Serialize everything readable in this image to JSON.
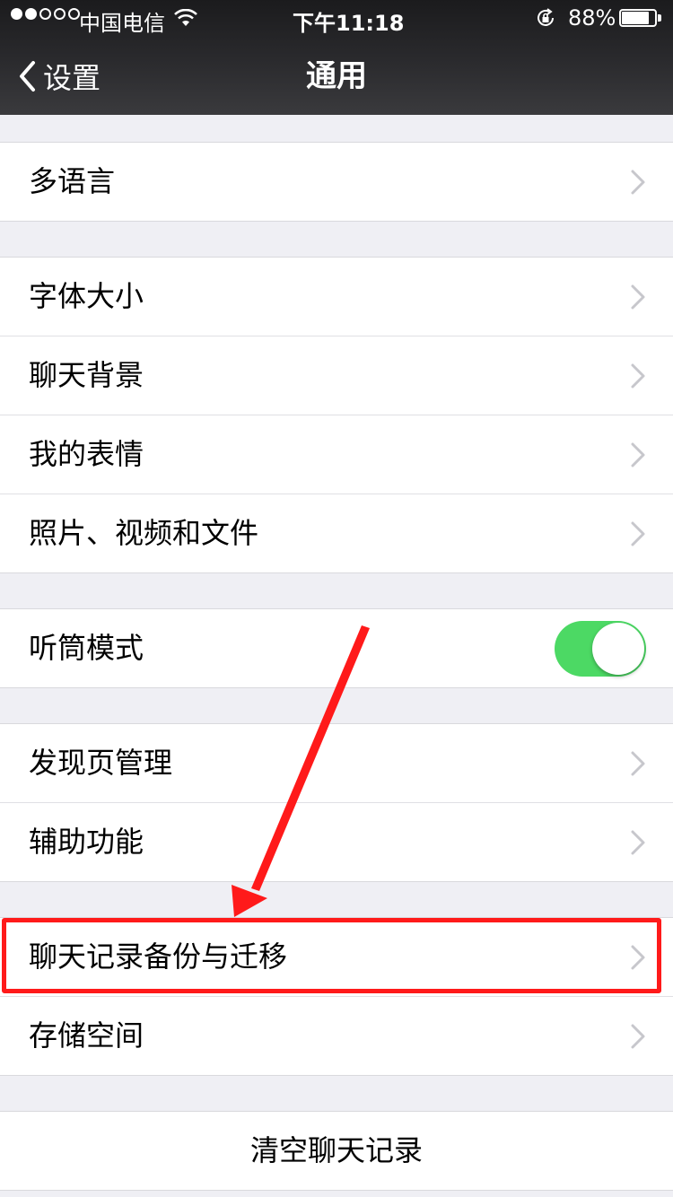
{
  "status_bar": {
    "signal_filled": 2,
    "signal_total": 5,
    "carrier": "中国电信",
    "time": "下午11:18",
    "battery_percent": "88%",
    "battery_level": 0.88,
    "icons": [
      "wifi-icon",
      "rotation-lock-icon",
      "battery-icon"
    ]
  },
  "nav": {
    "back_label": "设置",
    "title": "通用"
  },
  "groups": [
    {
      "items": [
        {
          "label": "多语言",
          "accessory": "chevron"
        }
      ]
    },
    {
      "items": [
        {
          "label": "字体大小",
          "accessory": "chevron"
        },
        {
          "label": "聊天背景",
          "accessory": "chevron"
        },
        {
          "label": "我的表情",
          "accessory": "chevron"
        },
        {
          "label": "照片、视频和文件",
          "accessory": "chevron"
        }
      ]
    },
    {
      "items": [
        {
          "label": "听筒模式",
          "accessory": "toggle",
          "toggle_on": true
        }
      ]
    },
    {
      "items": [
        {
          "label": "发现页管理",
          "accessory": "chevron"
        },
        {
          "label": "辅助功能",
          "accessory": "chevron"
        }
      ]
    },
    {
      "items": [
        {
          "label": "聊天记录备份与迁移",
          "accessory": "chevron",
          "highlighted": true
        },
        {
          "label": "存储空间",
          "accessory": "chevron"
        }
      ]
    }
  ],
  "clear_button": {
    "label": "清空聊天记录"
  },
  "colors": {
    "toggle_on": "#4cd964",
    "annotation": "#ff1a1a",
    "background": "#efeff4",
    "navbar": "#2b2b2e"
  }
}
